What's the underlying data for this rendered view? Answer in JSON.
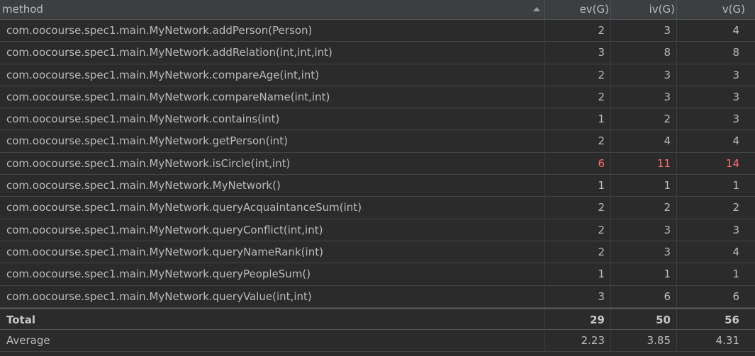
{
  "header": {
    "method": "method",
    "ev": "ev(G)",
    "iv": "iv(G)",
    "v": "v(G)"
  },
  "rows": [
    {
      "method": "com.oocourse.spec1.main.MyNetwork.addPerson(Person)",
      "ev": "2",
      "iv": "3",
      "v": "4"
    },
    {
      "method": "com.oocourse.spec1.main.MyNetwork.addRelation(int,int,int)",
      "ev": "3",
      "iv": "8",
      "v": "8"
    },
    {
      "method": "com.oocourse.spec1.main.MyNetwork.compareAge(int,int)",
      "ev": "2",
      "iv": "3",
      "v": "3"
    },
    {
      "method": "com.oocourse.spec1.main.MyNetwork.compareName(int,int)",
      "ev": "2",
      "iv": "3",
      "v": "3"
    },
    {
      "method": "com.oocourse.spec1.main.MyNetwork.contains(int)",
      "ev": "1",
      "iv": "2",
      "v": "3"
    },
    {
      "method": "com.oocourse.spec1.main.MyNetwork.getPerson(int)",
      "ev": "2",
      "iv": "4",
      "v": "4"
    },
    {
      "method": "com.oocourse.spec1.main.MyNetwork.isCircle(int,int)",
      "ev": "6",
      "iv": "11",
      "v": "14"
    },
    {
      "method": "com.oocourse.spec1.main.MyNetwork.MyNetwork()",
      "ev": "1",
      "iv": "1",
      "v": "1"
    },
    {
      "method": "com.oocourse.spec1.main.MyNetwork.queryAcquaintanceSum(int)",
      "ev": "2",
      "iv": "2",
      "v": "2"
    },
    {
      "method": "com.oocourse.spec1.main.MyNetwork.queryConflict(int,int)",
      "ev": "2",
      "iv": "3",
      "v": "3"
    },
    {
      "method": "com.oocourse.spec1.main.MyNetwork.queryNameRank(int)",
      "ev": "2",
      "iv": "3",
      "v": "4"
    },
    {
      "method": "com.oocourse.spec1.main.MyNetwork.queryPeopleSum()",
      "ev": "1",
      "iv": "1",
      "v": "1"
    },
    {
      "method": "com.oocourse.spec1.main.MyNetwork.queryValue(int,int)",
      "ev": "3",
      "iv": "6",
      "v": "6"
    }
  ],
  "total": {
    "label": "Total",
    "ev": "29",
    "iv": "50",
    "v": "56"
  },
  "average": {
    "label": "Average",
    "ev": "2.23",
    "iv": "3.85",
    "v": "4.31"
  },
  "colors": {
    "highlight": "#ff6b68",
    "background": "#2b2b2b",
    "header": "#3c3f41"
  },
  "sort_icon": "sort-ascending-icon"
}
